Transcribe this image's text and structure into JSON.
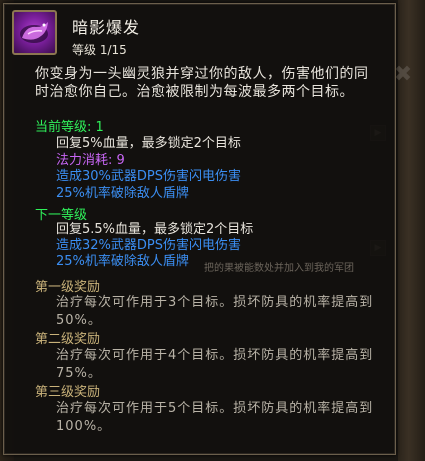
{
  "skill": {
    "name": "暗影爆发",
    "level": "等级 1/15",
    "description": "你变身为一头幽灵狼并穿过你的敌人，伤害他们的同时治愈你自己。治愈被限制为每波最多两个目标。",
    "icon": "shadow-wolf-icon"
  },
  "current": {
    "header": "当前等级: 1",
    "heal": "回复5%血量，最多锁定2个目标",
    "mana": "法力消耗: 9",
    "damage": "造成30%武器DPS伤害闪电伤害",
    "shield": "25%机率破除敌人盾牌"
  },
  "next": {
    "header": "下一等级",
    "heal": "回复5.5%血量，最多锁定2个目标",
    "damage": "造成32%武器DPS伤害闪电伤害",
    "shield": "25%机率破除敌人盾牌"
  },
  "rewards": [
    {
      "title": "第一级奖励",
      "text": "治疗每次可作用于3个目标。损坏防具的机率提高到50%。"
    },
    {
      "title": "第二级奖励",
      "text": "治疗每次可作用于4个目标。损坏防具的机率提高到75%。"
    },
    {
      "title": "第三级奖励",
      "text": "治疗每次可作用于5个目标。损坏防具的机率提高到100%。"
    }
  ],
  "background": {
    "close_glyph": "✖",
    "faded_text": "把的果被能数处并加入到我的军团"
  },
  "colors": {
    "green": "#2ff05a",
    "gold": "#c9b27a",
    "purple": "#c866f5",
    "blue": "#3b8ef2",
    "text": "#e8e4dc"
  }
}
